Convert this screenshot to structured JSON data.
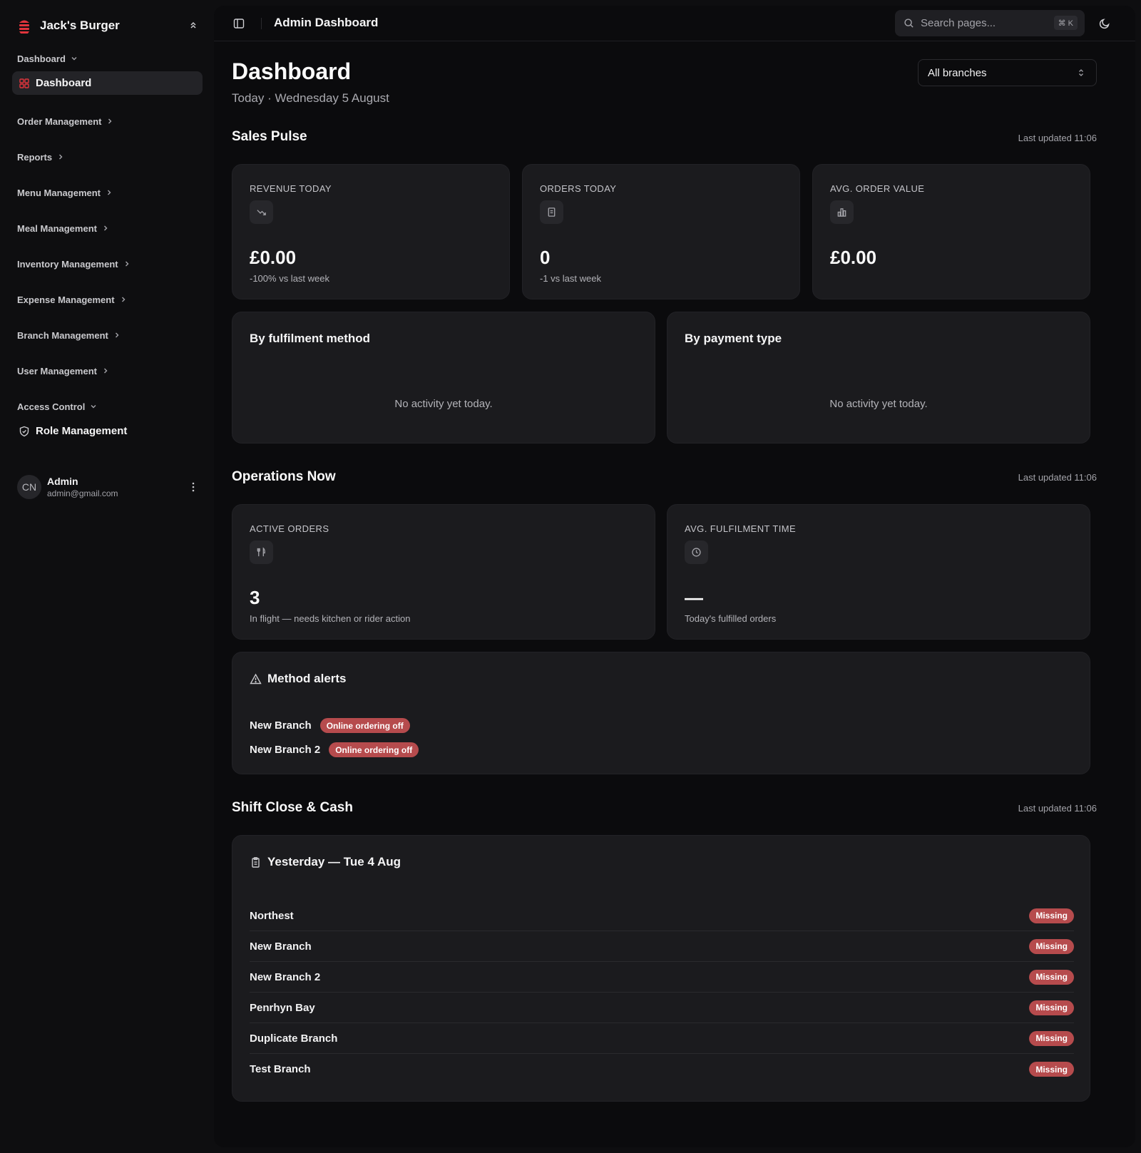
{
  "sidebar": {
    "brand": "Jack's Burger",
    "groups": {
      "dashboard": "Dashboard",
      "order": "Order Management",
      "reports": "Reports",
      "menu": "Menu Management",
      "meal": "Meal Management",
      "inventory": "Inventory Management",
      "expense": "Expense Management",
      "branch": "Branch Management",
      "user": "User Management",
      "access": "Access Control"
    },
    "items": {
      "dashboard": "Dashboard",
      "roles": "Role Management"
    },
    "user": {
      "initials": "CN",
      "name": "Admin",
      "email": "admin@gmail.com"
    }
  },
  "topbar": {
    "title": "Admin Dashboard",
    "search_placeholder": "Search pages...",
    "shortcut": "⌘ K"
  },
  "page": {
    "title": "Dashboard",
    "subtitle": "Today · Wednesday 5 August",
    "branch_select": "All branches"
  },
  "sales_pulse": {
    "title": "Sales Pulse",
    "updated": "Last updated 11:06",
    "stats": [
      {
        "label": "REVENUE TODAY",
        "icon": "trending-down-icon",
        "value": "£0.00",
        "note": "-100% vs last week"
      },
      {
        "label": "ORDERS TODAY",
        "icon": "receipt-icon",
        "value": "0",
        "note": "-1 vs last week"
      },
      {
        "label": "AVG. ORDER VALUE",
        "icon": "bar-chart-icon",
        "value": "£0.00",
        "note": ""
      }
    ],
    "fulfilment": {
      "title": "By fulfilment method",
      "empty": "No activity yet today."
    },
    "payment": {
      "title": "By payment type",
      "empty": "No activity yet today."
    }
  },
  "operations": {
    "title": "Operations Now",
    "updated": "Last updated 11:06",
    "active": {
      "label": "ACTIVE ORDERS",
      "icon": "utensils-icon",
      "value": "3",
      "note": "In flight — needs kitchen or rider action"
    },
    "fulfilment_time": {
      "label": "AVG. FULFILMENT TIME",
      "icon": "clock-icon",
      "value": "—",
      "note": "Today's fulfilled orders"
    },
    "alerts": {
      "title": "Method alerts",
      "rows": [
        {
          "branch": "New Branch",
          "status": "Online ordering off"
        },
        {
          "branch": "New Branch 2",
          "status": "Online ordering off"
        }
      ]
    }
  },
  "shift": {
    "title": "Shift Close & Cash",
    "updated": "Last updated 11:06",
    "card_title": "Yesterday — Tue 4 Aug",
    "rows": [
      {
        "branch": "Northest",
        "status": "Missing"
      },
      {
        "branch": "New Branch",
        "status": "Missing"
      },
      {
        "branch": "New Branch 2",
        "status": "Missing"
      },
      {
        "branch": "Penrhyn Bay",
        "status": "Missing"
      },
      {
        "branch": "Duplicate Branch",
        "status": "Missing"
      },
      {
        "branch": "Test Branch",
        "status": "Missing"
      }
    ]
  },
  "colors": {
    "accent": "#e0343c",
    "badge": "#b64b4d",
    "card": "#1b1b1e",
    "background": "#0b0b0d"
  }
}
